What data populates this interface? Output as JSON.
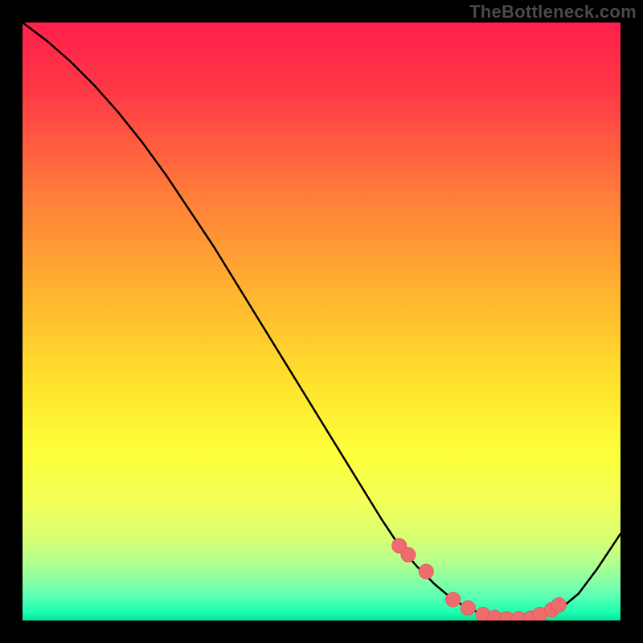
{
  "watermark": "TheBottleneck.com",
  "chart_data": {
    "type": "line",
    "title": "",
    "xlabel": "",
    "ylabel": "",
    "xlim": [
      0,
      100
    ],
    "ylim": [
      0,
      100
    ],
    "grid": false,
    "legend_position": "none",
    "background": {
      "type": "vertical-gradient",
      "stops": [
        {
          "offset": 0.0,
          "color": "#ff1f4b"
        },
        {
          "offset": 0.12,
          "color": "#ff3a46"
        },
        {
          "offset": 0.28,
          "color": "#ff7a3a"
        },
        {
          "offset": 0.45,
          "color": "#ffb330"
        },
        {
          "offset": 0.6,
          "color": "#ffe22c"
        },
        {
          "offset": 0.72,
          "color": "#fdff3a"
        },
        {
          "offset": 0.8,
          "color": "#f3ff57"
        },
        {
          "offset": 0.86,
          "color": "#d9ff73"
        },
        {
          "offset": 0.9,
          "color": "#b7ff8b"
        },
        {
          "offset": 0.93,
          "color": "#8dffa2"
        },
        {
          "offset": 0.96,
          "color": "#5affb6"
        },
        {
          "offset": 0.985,
          "color": "#1effaf"
        },
        {
          "offset": 1.0,
          "color": "#07e39c"
        }
      ]
    },
    "series": [
      {
        "name": "bottleneck-curve",
        "color": "#000000",
        "width": 2.5,
        "x": [
          0,
          4,
          8,
          12,
          16,
          20,
          24,
          28,
          32,
          36,
          40,
          44,
          48,
          52,
          56,
          60,
          63,
          66,
          69,
          72,
          75,
          78,
          81,
          84,
          87,
          90,
          93,
          96,
          100
        ],
        "y": [
          100,
          97.0,
          93.5,
          89.5,
          85.0,
          80.0,
          74.5,
          68.5,
          62.5,
          56.0,
          49.5,
          43.0,
          36.5,
          30.0,
          23.5,
          17.0,
          12.5,
          9.0,
          6.0,
          3.5,
          1.8,
          0.8,
          0.3,
          0.3,
          0.8,
          2.0,
          4.5,
          8.5,
          14.5
        ]
      }
    ],
    "markers": {
      "name": "highlight-dots",
      "color": "#ee6b6e",
      "radius": 9,
      "stroke": "#e95a5e",
      "x": [
        63.0,
        64.5,
        67.5,
        72.0,
        74.5,
        77.0,
        79.0,
        81.0,
        83.0,
        85.0,
        86.5,
        88.5,
        89.7
      ],
      "y": [
        12.5,
        11.0,
        8.2,
        3.5,
        2.1,
        1.0,
        0.5,
        0.3,
        0.3,
        0.4,
        1.0,
        1.8,
        2.6
      ]
    }
  }
}
